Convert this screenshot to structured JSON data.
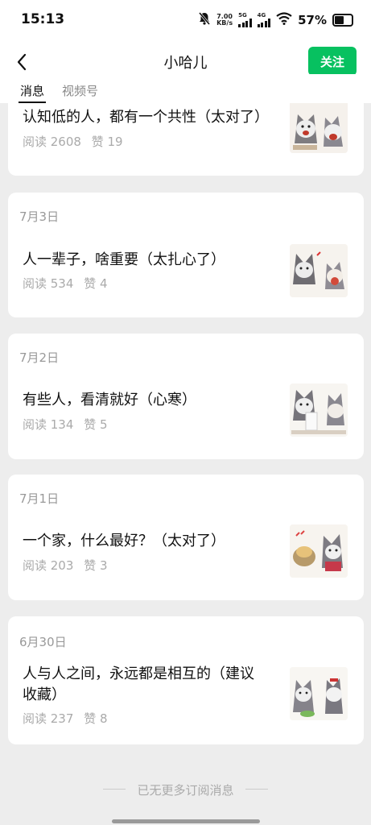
{
  "status_bar": {
    "time": "15:13",
    "net_speed_value": "7.00",
    "net_speed_unit": "KB/s",
    "sig1_label": "5G",
    "sig2_label": "4G",
    "battery_percent": "57%",
    "battery_level": 0.57,
    "icons": [
      "bell-muted-icon",
      "signal-icon",
      "wifi-icon",
      "battery-icon"
    ]
  },
  "header": {
    "title": "小哈儿",
    "follow_label": "关注",
    "accent_color": "#07c160"
  },
  "tabs": [
    {
      "label": "消息",
      "active": true
    },
    {
      "label": "视频号",
      "active": false
    }
  ],
  "articles": [
    {
      "date": "",
      "title": "认知低的人，都有一个共性（太对了）",
      "reads": "阅读 2608",
      "likes": "赞 19"
    },
    {
      "date": "7月3日",
      "title": "人一辈子，啥重要（太扎心了）",
      "reads": "阅读 534",
      "likes": "赞 4"
    },
    {
      "date": "7月2日",
      "title": "有些人，看清就好（心寒）",
      "reads": "阅读 134",
      "likes": "赞 5"
    },
    {
      "date": "7月1日",
      "title": "一个家，什么最好？（太对了）",
      "reads": "阅读 203",
      "likes": "赞 3"
    },
    {
      "date": "6月30日",
      "title_line1": "人与人之间，永远都是相互的（建议",
      "title_line2": "收藏）",
      "reads": "阅读 237",
      "likes": "赞 8"
    }
  ],
  "end_notice": "已无更多订阅消息"
}
